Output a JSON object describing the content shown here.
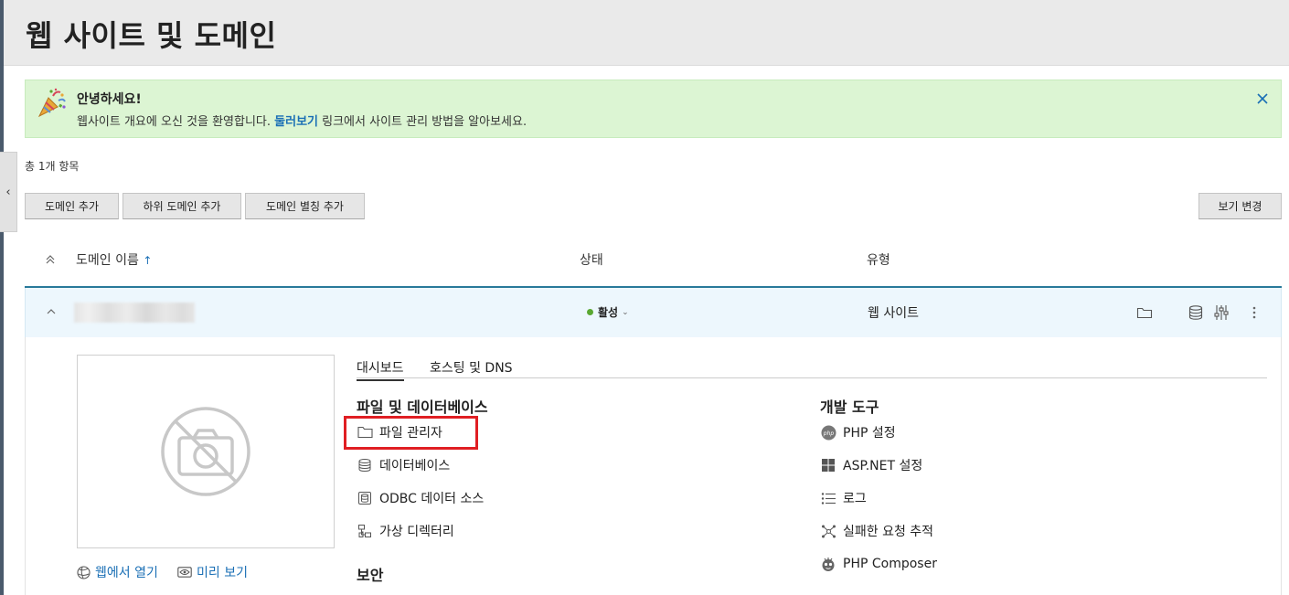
{
  "page": {
    "title": "웹 사이트 및 도메인"
  },
  "welcome": {
    "title": "안녕하세요!",
    "text_before": "웹사이트 개요에 오신 것을 환영합니다. ",
    "link": "둘러보기",
    "text_after": " 링크에서 사이트 관리 방법을 알아보세요."
  },
  "list": {
    "total": "총 1개 항목"
  },
  "toolbar": {
    "add_domain": "도메인 추가",
    "add_subdomain": "하위 도메인 추가",
    "add_alias": "도메인 별칭 추가",
    "change_view": "보기 변경"
  },
  "table": {
    "col_name": "도메인 이름",
    "sort_arrow": "↑",
    "col_status": "상태",
    "col_type": "유형"
  },
  "row": {
    "status": "활성",
    "type": "웹 사이트"
  },
  "preview": {
    "open_web": "웹에서 열기",
    "preview": "미리 보기"
  },
  "tabs": {
    "dashboard": "대시보드",
    "hosting": "호스팅 및 DNS"
  },
  "files_section": {
    "title": "파일 및 데이터베이스",
    "items": [
      "파일 관리자",
      "데이터베이스",
      "ODBC 데이터 소스",
      "가상 디렉터리"
    ]
  },
  "dev_section": {
    "title": "개발 도구",
    "items": [
      "PHP 설정",
      "ASP.NET 설정",
      "로그",
      "실패한 요청 추적",
      "PHP Composer"
    ]
  },
  "security_section": {
    "title": "보안"
  },
  "colors": {
    "accent": "#1a6fb5",
    "header_line": "#28799a",
    "welcome_bg": "#dcf5d3",
    "status_active": "#5aa832",
    "highlight": "#e01e23"
  }
}
